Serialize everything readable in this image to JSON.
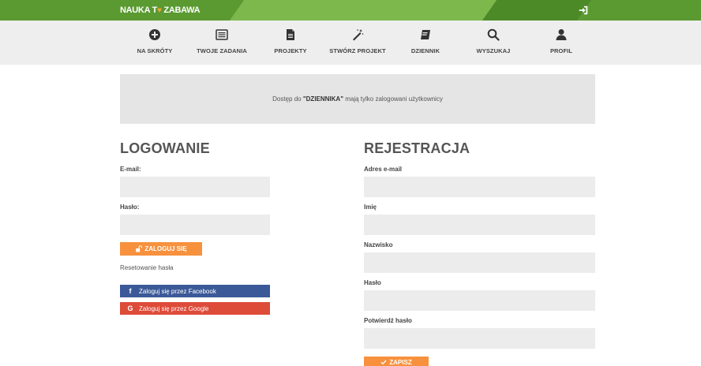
{
  "header": {
    "logo_text_1": "NAUKA T",
    "logo_text_2": "ZABAWA"
  },
  "nav": [
    {
      "label": "NA SKRÓTY",
      "icon": "plus-circle-icon"
    },
    {
      "label": "TWOJE ZADANIA",
      "icon": "list-icon"
    },
    {
      "label": "PROJEKTY",
      "icon": "file-icon"
    },
    {
      "label": "STWÓRZ PROJEKT",
      "icon": "magic-wand-icon"
    },
    {
      "label": "DZIENNIK",
      "icon": "book-icon"
    },
    {
      "label": "WYSZUKAJ",
      "icon": "search-icon"
    },
    {
      "label": "PROFIL",
      "icon": "user-icon"
    }
  ],
  "info": {
    "prefix": "Dostęp do ",
    "highlight": "\"DZIENNIKA\"",
    "suffix": " mają tylko zalogowani użytkownicy"
  },
  "login": {
    "title": "LOGOWANIE",
    "email_label": "E-mail:",
    "email_value": "",
    "password_label": "Hasło:",
    "password_value": "",
    "submit_label": "ZALOGUJ SIĘ",
    "reset_label": "Resetowanie hasła",
    "facebook_label": "Zaloguj się przez Facebook",
    "google_label": "Zaloguj się przez Google"
  },
  "register": {
    "title": "REJESTRACJA",
    "email_label": "Adres e-mail",
    "first_name_label": "Imię",
    "last_name_label": "Nazwisko",
    "password_label": "Hasło",
    "confirm_label": "Potwierdź hasło",
    "submit_label": "ZAPISZ"
  },
  "colors": {
    "brand_green": "#5a9a31",
    "accent_orange": "#f7913d",
    "facebook": "#3b5998",
    "google": "#dd4b39"
  }
}
